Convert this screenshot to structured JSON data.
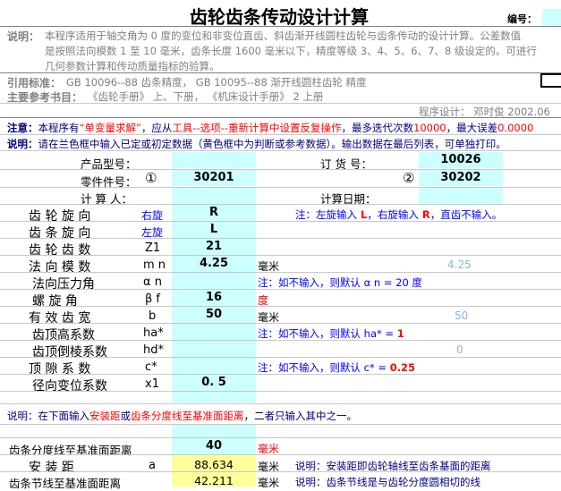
{
  "header": {
    "title": "齿轮齿条传动设计计算",
    "number_label": "编号："
  },
  "info": {
    "desc_label": "说明：",
    "desc_line1": "本程序适用于轴交角为 0 度的变位和非变位直齿、斜齿渐开线圆柱齿轮与齿条传动的设计计算。公差数值",
    "desc_line2": "是按照法向模数 1 至 10 毫米，齿条长度 1600 毫米以下，精度等级 3、4、5、6、7、8 级设定的。可进行",
    "desc_line3": "几何参数计算和传动质量指标的验算。",
    "std_label": "引用标准：",
    "std_text": "GB 10096--88  齿条精度， GB 10095--88  渐开线圆柱齿轮 精度",
    "ref_label": "主要参考书目：",
    "ref_text": "《齿轮手册》 上、下册，    《机床设计手册》 2 上册",
    "designer": "程序设计：  邓时俊  2002.06"
  },
  "notice": {
    "label": "注意：",
    "part1": "本程序有",
    "quote": "“单变量求解”",
    "part2": "，应从",
    "tools": "工具--选项--重新计算中设置反复操作",
    "part3": "，最多迭代次数",
    "iter": "10000",
    "part4": "，最大误差",
    "err": "0.0000"
  },
  "explain": {
    "label": "说明：",
    "text": "请在兰色框中输入已定或初定数据（黄色框中为判断或参考数据）。输出数据在最后列表，可单独打印。"
  },
  "order": {
    "product_label": "产品型号：",
    "order_label": "订 货 号：",
    "order_value": "10026",
    "part_label": "零件件号：",
    "part1_mark": "①",
    "part1_value": "30201",
    "part2_mark": "②",
    "part2_value": "30202",
    "calc_person_label": "计 算 人：",
    "calc_date_label": "计算日期："
  },
  "params": [
    {
      "label": "齿 轮 旋 向",
      "symbol": "右旋",
      "value": "R",
      "unit": "",
      "note": "注：左旋输入 L，右旋输入 R，直齿不输入。",
      "ref": ""
    },
    {
      "label": "齿 条 旋 向",
      "symbol": "左旋",
      "value": "L",
      "unit": "",
      "note": "",
      "ref": ""
    },
    {
      "label": "齿 轮 齿 数",
      "symbol": "Z1",
      "value": "21",
      "unit": "",
      "note": "",
      "ref": ""
    },
    {
      "label": "法 向 模 数",
      "symbol": "m n",
      "value": "4.25",
      "unit": "毫米",
      "note": "",
      "ref": "4.25"
    },
    {
      "label": "法向压力角",
      "symbol": "α n",
      "value": "",
      "unit": "",
      "note": "注：如不输入，则默认 α n = 20 度",
      "ref": ""
    },
    {
      "label": "螺 旋 角",
      "symbol": "β f",
      "value": "16",
      "unit": "度",
      "note": "",
      "ref": ""
    },
    {
      "label": "有 效 齿 宽",
      "symbol": "b",
      "value": "50",
      "unit": "毫米",
      "note": "",
      "ref": "50"
    },
    {
      "label": "齿顶高系数",
      "symbol": "ha*",
      "value": "",
      "unit": "",
      "note": "注：如不输入，则默认 ha* = 1",
      "ref": ""
    },
    {
      "label": "齿顶倒棱系数",
      "symbol": "hd*",
      "value": "",
      "unit": "",
      "note": "",
      "ref": "0"
    },
    {
      "label": "顶 隙 系 数",
      "symbol": "c*",
      "value": "",
      "unit": "",
      "note": "注：如不输入，则默认 c* = 0.25",
      "ref": ""
    },
    {
      "label": "径向变位系数",
      "symbol": "x1",
      "value": "0. 5",
      "unit": "",
      "note": "",
      "ref": ""
    }
  ],
  "input_note": {
    "label": "说明：",
    "part1": "在下面输入",
    "red1": "安装距",
    "part2": "或",
    "red2": "齿条分度线至基准面距离",
    "part3": "，二者只输入其中之一。"
  },
  "bottom": {
    "row1_label": "齿条分度线至基准面距离",
    "row1_value": "40",
    "row1_unit": "毫米",
    "row2_label": "安 装 距",
    "row2_symbol": "a",
    "row2_value": "88.634",
    "row2_unit": "毫米",
    "row2_note": "说明：安装距即齿轮轴线至齿条基面的距离",
    "row3_label": "齿条节线至基准面距离",
    "row3_value": "42.211",
    "row3_unit": "毫米",
    "row3_note": "说明：齿条节线是与齿轮分度圆相切的线"
  }
}
